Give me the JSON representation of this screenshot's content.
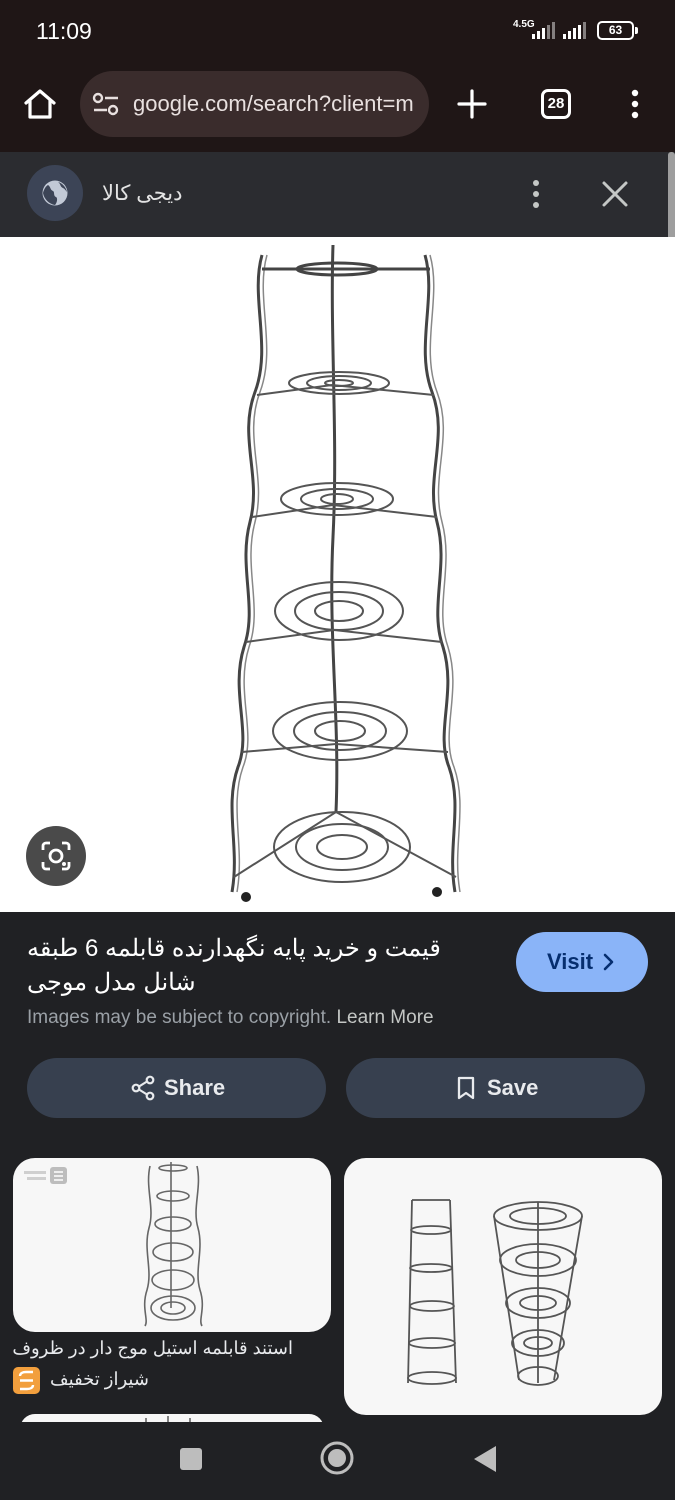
{
  "status_bar": {
    "time": "11:09",
    "network": "4.5G",
    "battery": "63"
  },
  "browser": {
    "url": "google.com/search?client=m",
    "tab_count": "28"
  },
  "sheet": {
    "site_name": "دیجی کالا"
  },
  "result": {
    "title": "قیمت و خرید پایه نگهدارنده قابلمه 6 طبقه شانل مدل موجی",
    "visit_label": "Visit",
    "copyright_text": "Images may be subject to copyright.",
    "learn_more": "Learn More",
    "share_label": "Share",
    "save_label": "Save"
  },
  "related": [
    {
      "caption": "استند قابلمه استیل موج دار در ظروف",
      "source": "شیراز تخفیف",
      "watermark": "شیراز تخفیف"
    },
    {
      "caption": "",
      "source": ""
    }
  ],
  "icons": {
    "home": "home-icon",
    "site_settings": "tune-icon",
    "new_tab": "plus-icon",
    "menu": "more-vert-icon",
    "globe": "globe-icon",
    "close": "close-icon",
    "lens": "google-lens-icon",
    "share": "share-icon",
    "save": "bookmark-icon"
  },
  "colors": {
    "toolbar_bg": "#1f1616",
    "sheet_bg": "#202124",
    "visit_button": "#8ab4f8",
    "action_button": "#37404f"
  }
}
